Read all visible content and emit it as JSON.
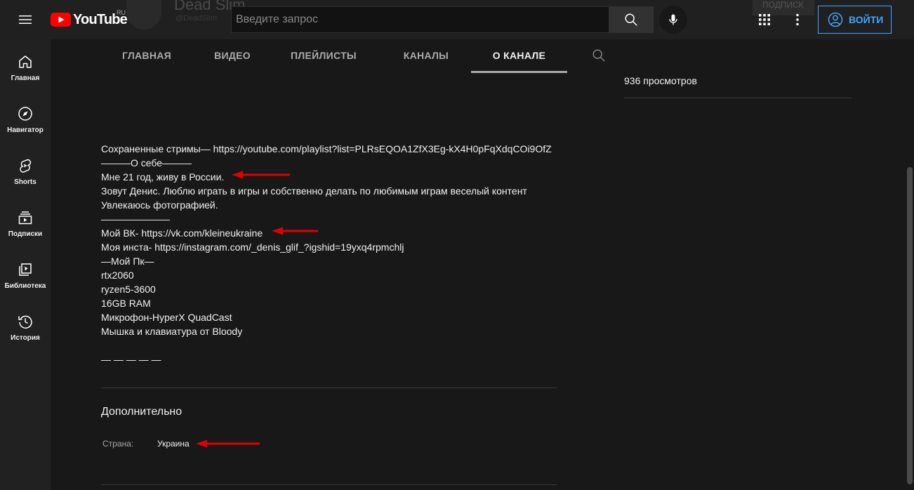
{
  "masthead": {
    "logo_text": "YouTube",
    "region": "RU",
    "search_placeholder": "Введите запрос",
    "signin_label": "ВОЙТИ"
  },
  "sidebar": {
    "items": [
      {
        "label": "Главная",
        "icon": "home-icon"
      },
      {
        "label": "Навигатор",
        "icon": "compass-icon"
      },
      {
        "label": "Shorts",
        "icon": "shorts-icon"
      },
      {
        "label": "Подписки",
        "icon": "subscriptions-icon"
      },
      {
        "label": "Библиотека",
        "icon": "library-icon"
      },
      {
        "label": "История",
        "icon": "history-icon"
      }
    ]
  },
  "tabs": [
    {
      "label": "ГЛАВНАЯ"
    },
    {
      "label": "ВИДЕО"
    },
    {
      "label": "ПЛЕЙЛИСТЫ"
    },
    {
      "label": "КАНАЛЫ"
    },
    {
      "label": "О КАНАЛЕ"
    }
  ],
  "about": {
    "description_lines": [
      "Сохраненные стримы— https://youtube.com/playlist?list=PLRsEQOA1ZfX3Eg-kX4H0pFqXdqCOi9OfZ",
      "———О себе———",
      "Мне 21 год, живу в России.",
      "Зовут Денис. Люблю играть в игры и собственно делать по любимым играм веселый контент",
      "Увлекаюсь фотографией.",
      "———————",
      "Мой ВК-  https://vk.com/kleineukraine",
      "Моя инста- https://instagram.com/_denis_glif_?igshid=19yxq4rpmchlj",
      "—Мой Пк—",
      "rtx2060",
      "ryzen5-3600",
      "16GB RAM",
      "Микрофон-HyperX QuadCast",
      "Мышка и клавиатура от Bloody",
      "",
      "— — — — —"
    ],
    "more_title": "Дополнительно",
    "country_label": "Страна:",
    "country_value": "Украина"
  },
  "stats": {
    "views": "936 просмотров"
  },
  "colors": {
    "accent_blue": "#3ea6ff",
    "annotation_red": "#e00000",
    "logo_red": "#ff0000"
  }
}
